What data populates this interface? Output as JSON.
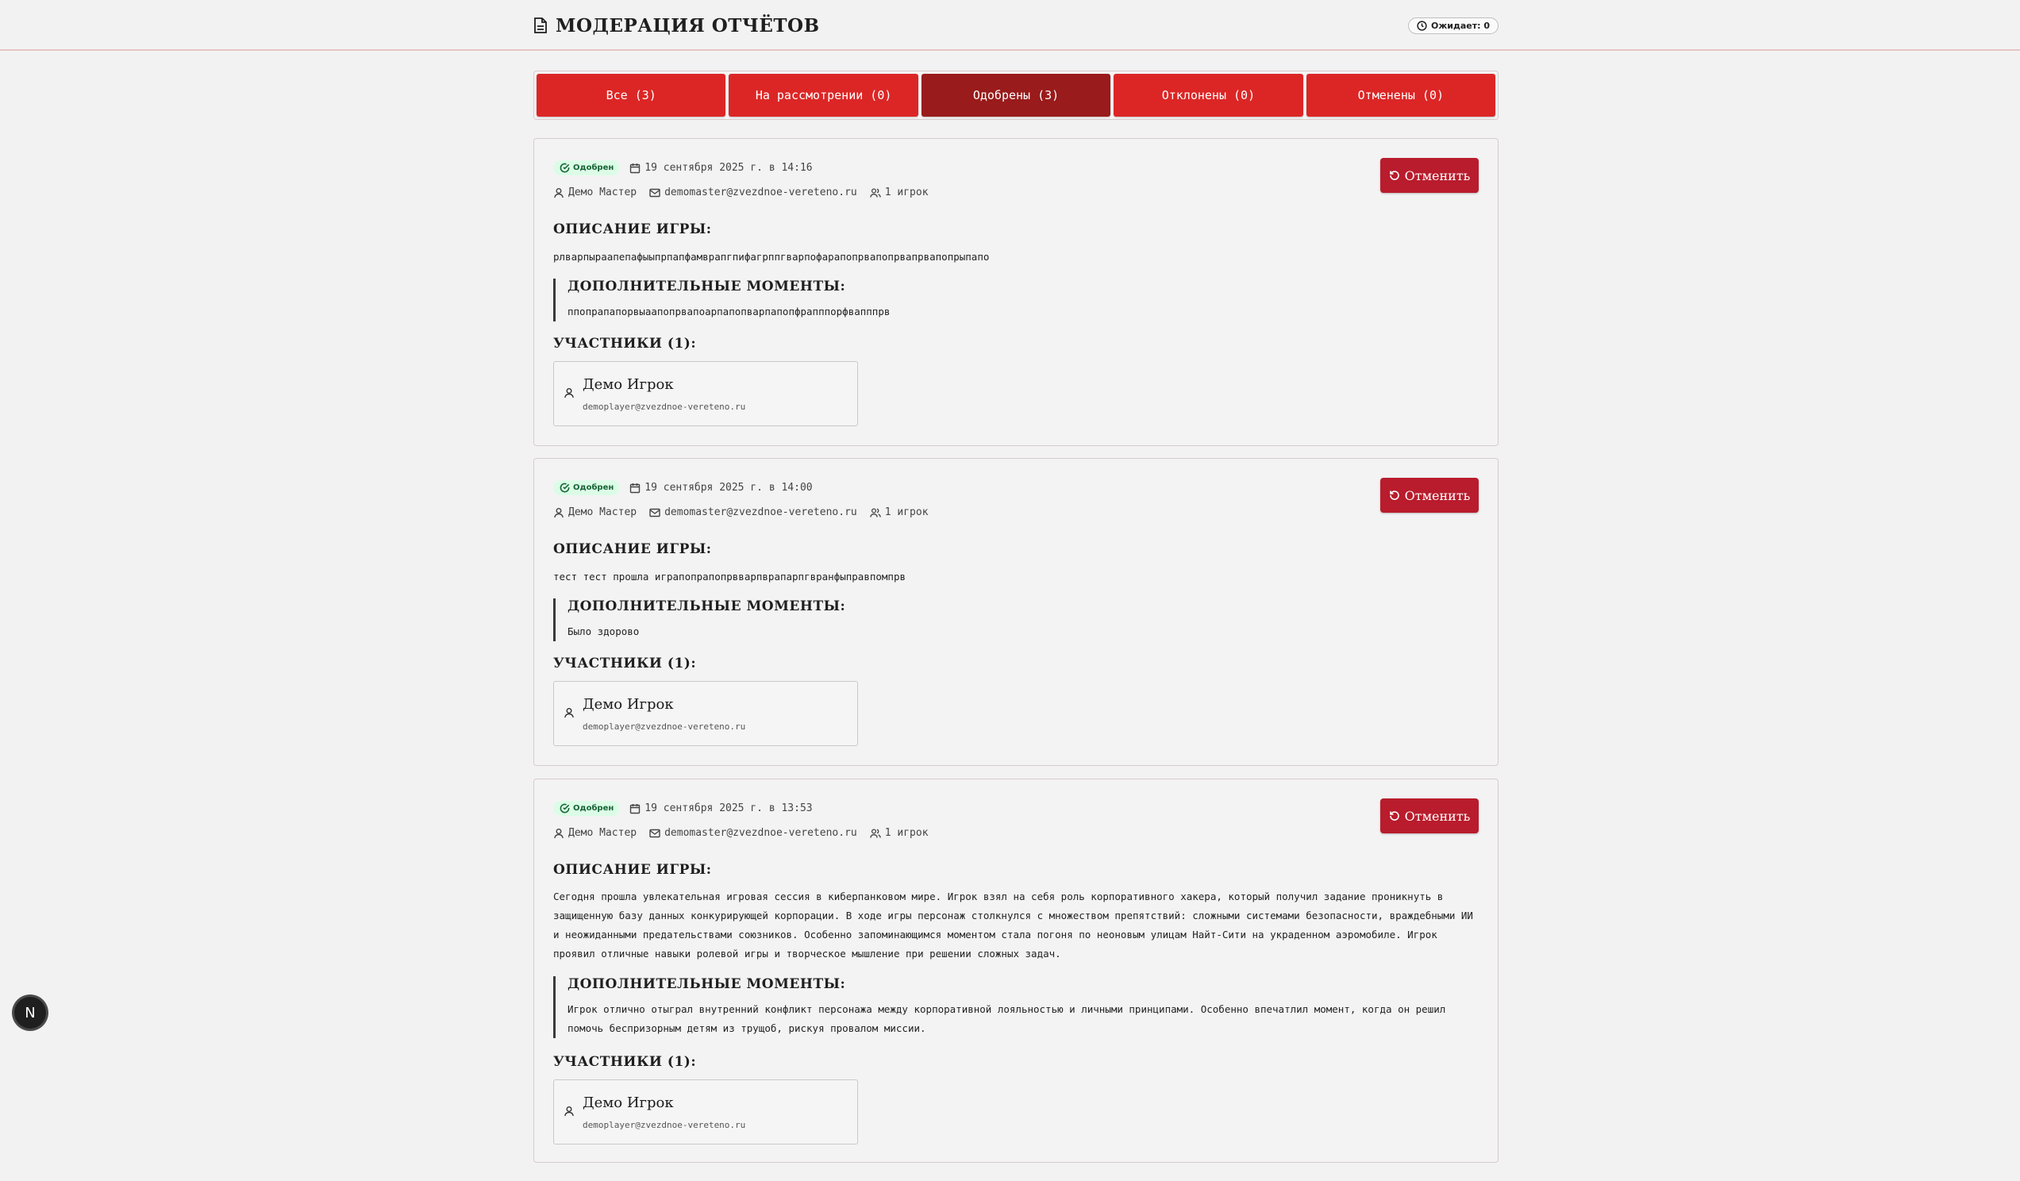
{
  "header": {
    "title": "МОДЕРАЦИЯ ОТЧЁТОВ",
    "pending_label": "Ожидает: 0"
  },
  "tabs": [
    {
      "label": "Все (3)",
      "active": false
    },
    {
      "label": "На рассмотрении (0)",
      "active": false
    },
    {
      "label": "Одобрены (3)",
      "active": true
    },
    {
      "label": "Отклонены (0)",
      "active": false
    },
    {
      "label": "Отменены (0)",
      "active": false
    }
  ],
  "labels": {
    "status": "Одобрен",
    "cancel": "Отменить",
    "description": "ОПИСАНИЕ ИГРЫ:",
    "extra": "ДОПОЛНИТЕЛЬНЫЕ МОМЕНТЫ:"
  },
  "reports": [
    {
      "date": "19 сентября 2025 г. в 14:16",
      "master": "Демо Мастер",
      "email": "demomaster@zvezdnoe-vereteno.ru",
      "players": "1 игрок",
      "description": "рлварпыраапепафыыпрпапфамврапгпифагрппгварпофарапопрвапопрвапрвапопрыпапо",
      "extra": "ппопрапапорвыаапопрвапоарпапопварпапопфрапппорфвапппрв",
      "participants_title": "УЧАСТНИКИ (1):",
      "participant": {
        "name": "Демо Игрок",
        "email": "demoplayer@zvezdnoe-vereteno.ru"
      }
    },
    {
      "date": "19 сентября 2025 г. в 14:00",
      "master": "Демо Мастер",
      "email": "demomaster@zvezdnoe-vereteno.ru",
      "players": "1 игрок",
      "description": "тест тест прошла играпопрапопрвварпврапарпгвранфыправпомпрв",
      "extra": "Было здорово",
      "participants_title": "УЧАСТНИКИ (1):",
      "participant": {
        "name": "Демо Игрок",
        "email": "demoplayer@zvezdnoe-vereteno.ru"
      }
    },
    {
      "date": "19 сентября 2025 г. в 13:53",
      "master": "Демо Мастер",
      "email": "demomaster@zvezdnoe-vereteno.ru",
      "players": "1 игрок",
      "description": "Сегодня прошла увлекательная игровая сессия в киберпанковом мире. Игрок взял на себя роль корпоративного хакера, который получил задание проникнуть в защищенную базу данных конкурирующей корпорации. В ходе игры персонаж столкнулся с множеством препятствий: сложными системами безопасности, враждебными ИИ и неожиданными предательствами союзников. Особенно запоминающимся моментом стала погоня по неоновым улицам Найт-Сити на украденном аэромобиле. Игрок проявил отличные навыки ролевой игры и творческое мышление при решении сложных задач.",
      "extra": "Игрок отлично отыграл внутренний конфликт персонажа между корпоративной лояльностью и личными принципами. Особенно впечатлил момент, когда он решил помочь беспризорным детям из трущоб, рискуя провалом миссии.",
      "participants_title": "УЧАСТНИКИ (1):",
      "participant": {
        "name": "Демо Игрок",
        "email": "demoplayer@zvezdnoe-vereteno.ru"
      }
    }
  ],
  "floating_badge": "N"
}
